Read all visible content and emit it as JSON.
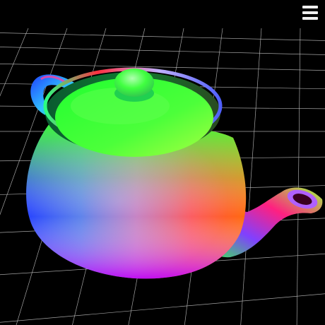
{
  "viewer": {
    "background": "#000000",
    "grid_color": "#bfbfbf",
    "shading": "normal-map",
    "object": "teapot"
  },
  "menu": {
    "icon": "hamburger-menu-icon",
    "color": "#f0f0f0"
  }
}
